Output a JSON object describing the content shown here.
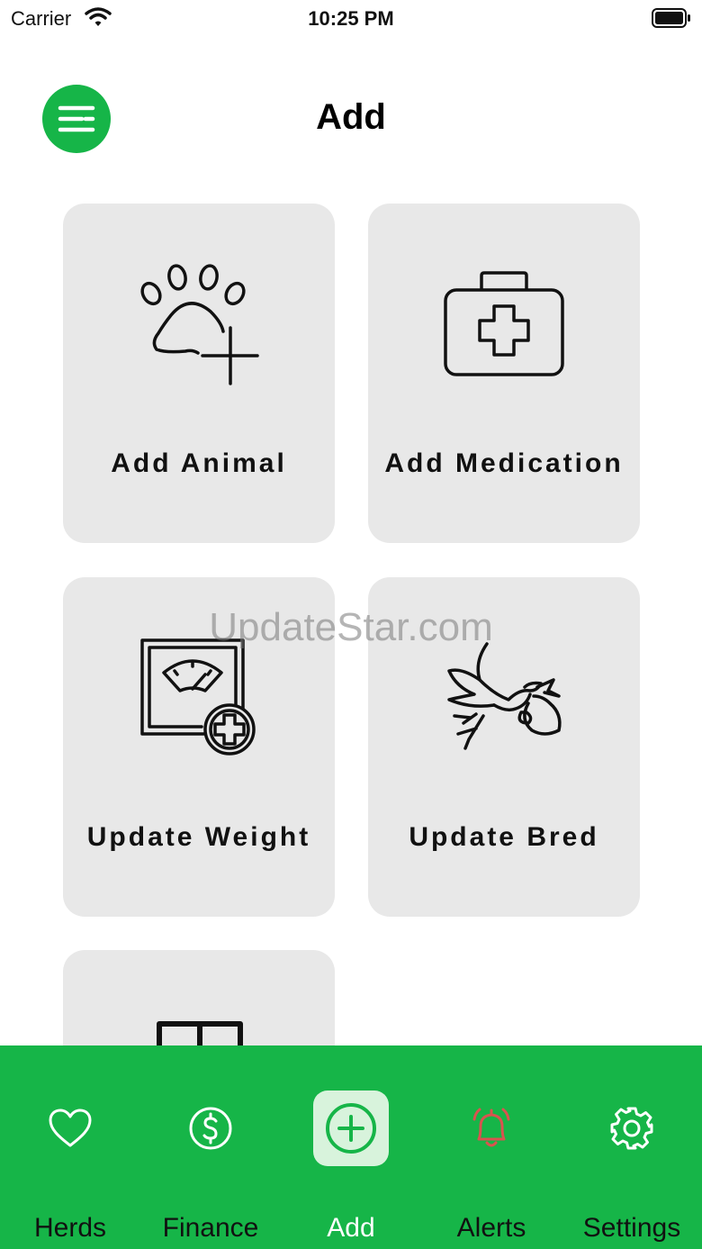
{
  "status_bar": {
    "carrier": "Carrier",
    "time": "10:25 PM"
  },
  "header": {
    "title": "Add",
    "menu_icon": "menu-lines-icon"
  },
  "cards": [
    {
      "label": "Add Animal",
      "icon": "paw-plus-icon"
    },
    {
      "label": "Add Medication",
      "icon": "first-aid-kit-icon"
    },
    {
      "label": "Update Weight",
      "icon": "scale-plus-icon"
    },
    {
      "label": "Update Bred",
      "icon": "stork-icon"
    },
    {
      "label": "",
      "icon": "calendar-icon"
    }
  ],
  "watermark": "UpdateStar.com",
  "tab_bar": {
    "items": [
      {
        "label": "Herds",
        "icon": "heart-icon"
      },
      {
        "label": "Finance",
        "icon": "dollar-circle-icon"
      },
      {
        "label": "Add",
        "icon": "plus-circle-icon",
        "active": true
      },
      {
        "label": "Alerts",
        "icon": "bell-icon"
      },
      {
        "label": "Settings",
        "icon": "gear-icon"
      }
    ]
  },
  "colors": {
    "brand_green": "#16b548",
    "card_bg": "#e8e8e8",
    "alert_red": "#d9534f",
    "active_tab_bg": "#d8f3dc"
  }
}
